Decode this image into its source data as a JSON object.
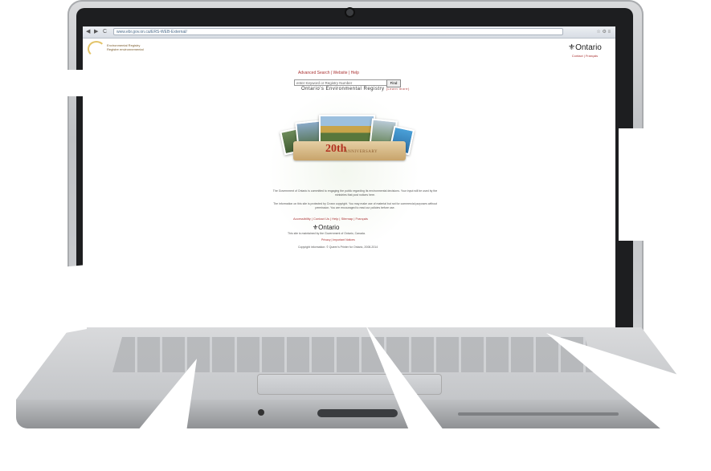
{
  "browser": {
    "url": "www.ebr.gov.on.ca/ERS-WEB-External/",
    "nav": {
      "back": "◀",
      "forward": "▶",
      "reload": "C"
    },
    "icons": "☆ ⚙ ≡"
  },
  "site": {
    "logo_line1": "Environmental Registry",
    "logo_line2": "Registre environnemental",
    "ontario_word": "Ontario",
    "top_right_links": "Contact | Français",
    "links_top": "Advanced Search | Website | Help",
    "search_placeholder": "enter Keyword or Registry Number",
    "find_label": "Find",
    "registry_title": "Ontario's Environmental Registry",
    "registry_title_small": "(Learn more)",
    "banner_number": "20th",
    "banner_word": "ANNIVERSARY",
    "paragraph1": "The Government of Ontario is committed to engaging the public regarding its environmental decisions. Your input will be used by the ministries that post notices here.",
    "paragraph2": "The information on this site is protected by Crown copyright. You may make use of material but not for commercial purposes without permission. You are encouraged to read our policies before use.",
    "footer_links": "Accessibility | Contact Us | Help | Sitemap | Français",
    "footer_ontario": "Ontario",
    "footer_note": "This site is maintained by the Government of Ontario, Canada.",
    "footer_links2": "Privacy | Important Notices",
    "copyright": "Copyright information: © Queen's Printer for Ontario, 2008-2014"
  },
  "colors": {
    "link": "#aa3333",
    "banner": "#c8a46b",
    "bezel": "#1d1e20",
    "aluminum": "#cfd1d4"
  }
}
